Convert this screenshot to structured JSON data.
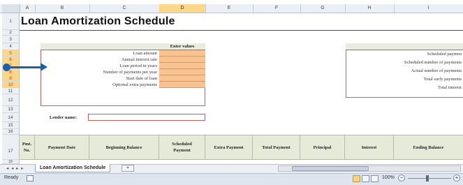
{
  "columns": [
    "A",
    "B",
    "C",
    "D",
    "E",
    "F",
    "G",
    "H",
    "I"
  ],
  "selected_column": "D",
  "rows": [
    "1",
    "2",
    "3",
    "4",
    "5",
    "6",
    "7",
    "8",
    "9",
    "10",
    "11",
    "12",
    "13",
    "14",
    "15",
    "16",
    "17",
    "18"
  ],
  "title": "Loan Amortization Schedule",
  "inputs": {
    "header": "Enter values",
    "fields": [
      {
        "label": "Loan amount"
      },
      {
        "label": "Annual interest rate"
      },
      {
        "label": "Loan period in years"
      },
      {
        "label": "Number of payments per year"
      },
      {
        "label": "Start date of loan"
      },
      {
        "label": "Optional extra payments"
      }
    ]
  },
  "lender_label": "Lender name:",
  "summary": {
    "items": [
      "Scheduled paymen",
      "Scheduled number of payments",
      "Actual number of payments",
      "Total early payments",
      "Total interest"
    ]
  },
  "table_headers": [
    "Pmt.\nNo.",
    "Payment Date",
    "Beginning Balance",
    "Scheduled\nPayment",
    "Extra Payment",
    "Total Payment",
    "Principal",
    "Interest",
    "Ending Balance"
  ],
  "sheet_tab": "Loan Amortization Schedule",
  "nav_arrows": "◂ ◂ ▸ ▸",
  "status": {
    "ready": "Ready",
    "zoom": "100%"
  },
  "colors": {
    "input_fill": "#f8c391",
    "arrow": "#1f5fa8",
    "accent_border": "#c26060"
  },
  "icons": [
    "pointer-arrow-icon",
    "new-sheet-icon",
    "macro-record-icon",
    "normal-view-icon",
    "page-layout-icon",
    "page-break-icon",
    "zoom-out-icon",
    "zoom-in-icon"
  ]
}
